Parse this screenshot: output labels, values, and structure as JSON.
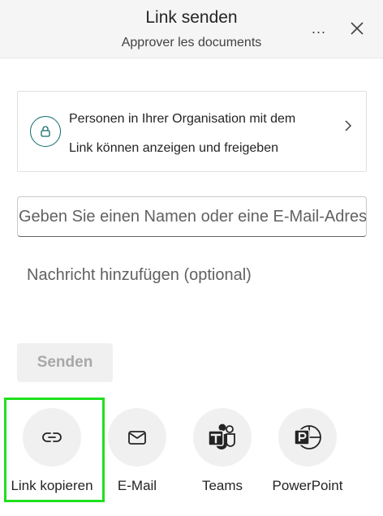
{
  "header": {
    "title": "Link senden",
    "subtitle": "Approver les documents",
    "more_label": "...",
    "close_icon": "close-icon"
  },
  "permission": {
    "line1": "Personen in Ihrer Organisation mit dem",
    "line2": "Link können anzeigen und freigeben",
    "icon": "lock-icon"
  },
  "to_field": {
    "value": "",
    "placeholder": "Geben Sie einen Namen oder eine E-Mail-Adresse ein"
  },
  "message_field": {
    "value": "",
    "placeholder": "Nachricht hinzufügen (optional)"
  },
  "send_button": {
    "label": "Senden",
    "enabled": false
  },
  "share_options": [
    {
      "label": "Link kopieren",
      "icon": "link-icon",
      "highlighted": true
    },
    {
      "label": "E-Mail",
      "icon": "mail-icon"
    },
    {
      "label": "Teams",
      "icon": "teams-icon"
    },
    {
      "label": "PowerPoint",
      "icon": "powerpoint-icon"
    }
  ],
  "colors": {
    "highlight": "#1ee01e",
    "lock_accent": "#0f6b6b",
    "header_bg": "#f5f5f5",
    "button_bg": "#f0f0f0"
  }
}
